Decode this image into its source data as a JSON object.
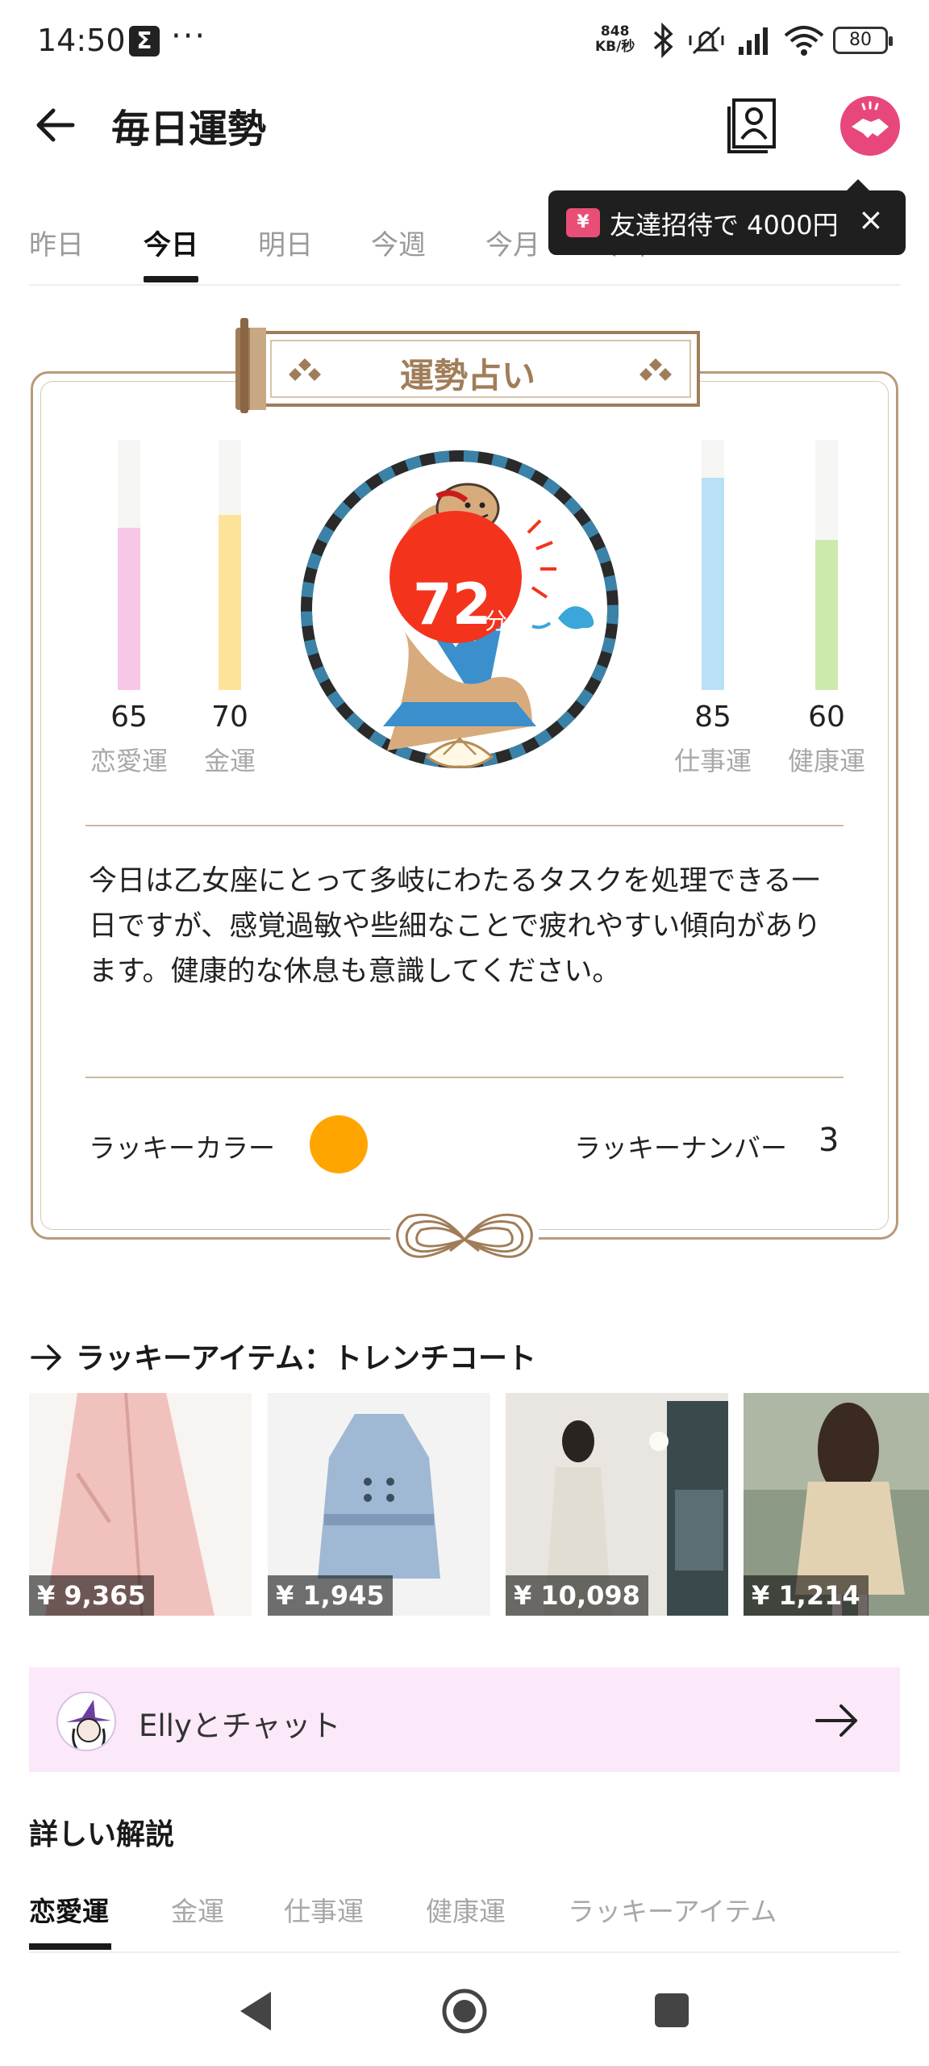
{
  "status_bar": {
    "time": "14:50",
    "sigma_icon_label": "Σ",
    "more": "···",
    "net_speed_value": "848",
    "net_speed_unit": "KB/秒",
    "battery": "80"
  },
  "header": {
    "title": "毎日運勢",
    "icons": [
      "back-arrow-icon",
      "contact-card-icon",
      "handshake-icon"
    ]
  },
  "period_tabs": {
    "items": [
      "昨日",
      "今日",
      "明日",
      "今週",
      "今月",
      "今年"
    ],
    "selected": "今日"
  },
  "invite_tooltip": {
    "ticket_symbol": "¥",
    "text": "友達招待で 4000円",
    "close": "×"
  },
  "fortune": {
    "banner_title": "運勢占い",
    "total_score": "72",
    "total_unit": "分",
    "categories": [
      {
        "label": "恋愛運",
        "score": "65",
        "level": 0.65,
        "color": "#F8C6E6"
      },
      {
        "label": "金運",
        "score": "70",
        "level": 0.7,
        "color": "#FDE39A"
      },
      {
        "label": "仕事運",
        "score": "85",
        "level": 0.85,
        "color": "#B9E0F6"
      },
      {
        "label": "健康運",
        "score": "60",
        "level": 0.6,
        "color": "#CDEAAC"
      }
    ],
    "description": "今日は乙女座にとって多岐にわたるタスクを処理できる一日ですが、感覚過敏や些細なことで疲れやすい傾向があります。健康的な休息も意識してください。",
    "lucky_color_label": "ラッキーカラー",
    "lucky_color": "#FFA500",
    "lucky_number_label": "ラッキーナンバー",
    "lucky_number": "3"
  },
  "lucky_item": {
    "title": "ラッキーアイテム：トレンチコート",
    "products": [
      {
        "price": "¥ 9,365",
        "color": "#f0c9c6"
      },
      {
        "price": "¥ 1,945",
        "color": "#9fb8d3"
      },
      {
        "price": "¥ 10,098",
        "color": "#e8e2d8"
      },
      {
        "price": "¥ 1,214",
        "color": "#d9c6a6"
      }
    ]
  },
  "chat": {
    "label": "Ellyとチャット"
  },
  "details": {
    "title": "詳しい解説",
    "tabs": [
      "恋愛運",
      "金運",
      "仕事運",
      "健康運",
      "ラッキーアイテム"
    ],
    "selected": "恋愛運"
  }
}
